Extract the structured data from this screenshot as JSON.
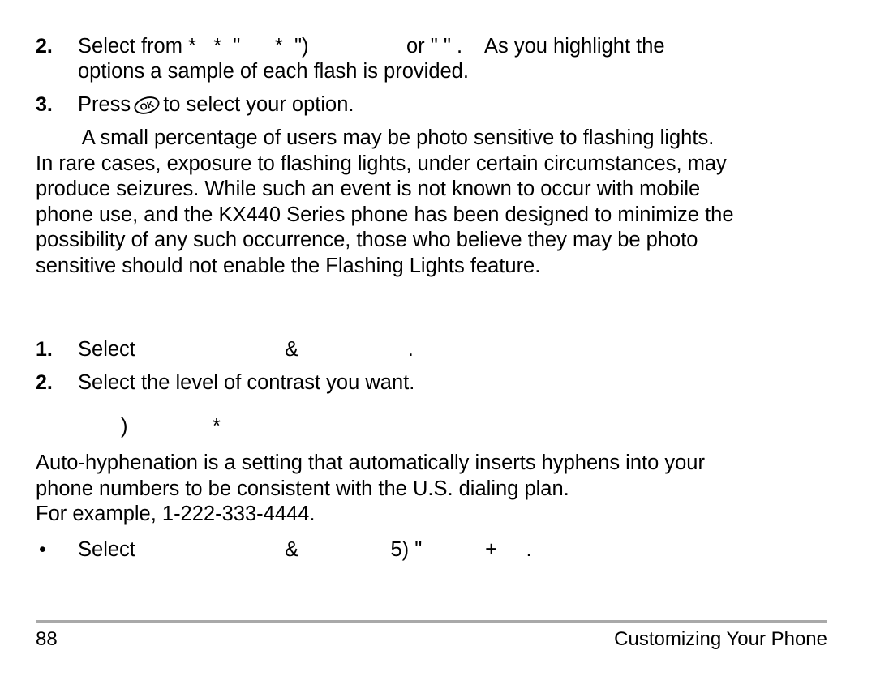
{
  "page": {
    "number": "88",
    "footer_title": "Customizing Your Phone"
  },
  "flashing_lights": {
    "step2": {
      "marker": "2.",
      "text": "Select from *   *  \"      *  \")                 or \" \" .    As you highlight the\noptions a sample of each flash is provided."
    },
    "step3": {
      "marker": "3.",
      "text_before": "Press",
      "icon": "ok-key-icon",
      "icon_label": "OK",
      "text_after": "to select your option."
    },
    "note": "        A small percentage of users may be photo sensitive to flashing lights.\nIn rare cases, exposure to flashing lights, under certain circumstances, may\nproduce seizures. While such an event is not known to occur with mobile\nphone use, and the KX440 Series phone has been designed to minimize the\npossibility of any such occurrence, those who believe they may be photo\nsensitive should not enable the Flashing Lights feature."
  },
  "contrast": {
    "step1": {
      "marker": "1.",
      "text": "Select                          &                   ."
    },
    "step2": {
      "marker": "2.",
      "text": "Select the level of contrast you want."
    }
  },
  "hyphenation": {
    "heading_glyph_1": ")",
    "heading_glyph_2": "*",
    "body": "Auto-hyphenation is a setting that automatically inserts hyphens into your\nphone numbers to be consistent with the U.S. dialing plan.\nFor example, 1-222-333-4444.",
    "bullet": {
      "marker": "•",
      "text": "Select                          &                5) \"           +     ."
    }
  }
}
